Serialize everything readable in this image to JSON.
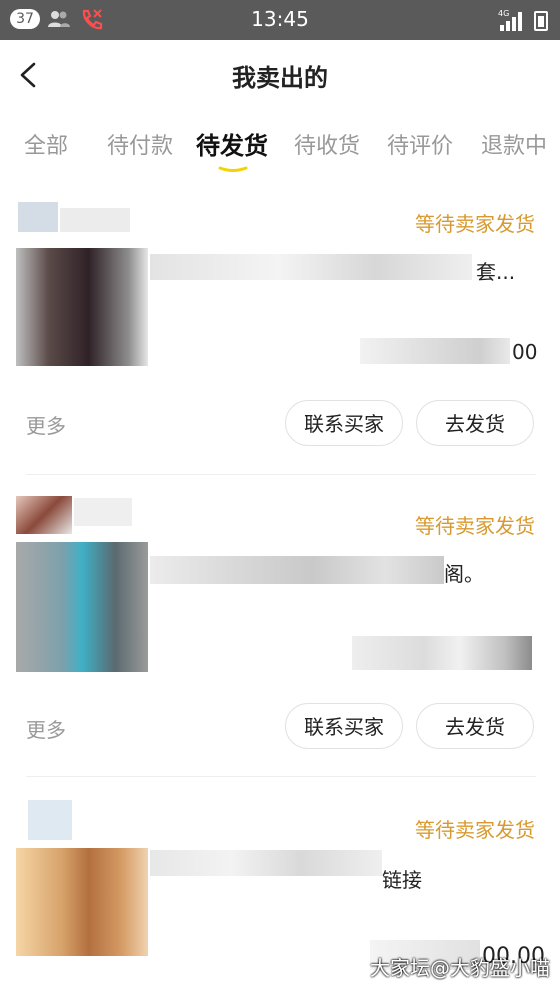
{
  "status_bar": {
    "notification_count": "37",
    "time": "13:45",
    "network": "4G"
  },
  "header": {
    "title": "我卖出的"
  },
  "tabs": [
    {
      "label": "全部"
    },
    {
      "label": "待付款"
    },
    {
      "label": "待发货"
    },
    {
      "label": "待收货"
    },
    {
      "label": "待评价"
    },
    {
      "label": "退款中"
    }
  ],
  "active_tab": "待发货",
  "orders": [
    {
      "status": "等待卖家发货",
      "title_tail": "套...",
      "price_tail": "00",
      "more_label": "更多",
      "contact_label": "联系买家",
      "ship_label": "去发货"
    },
    {
      "status": "等待卖家发货",
      "title_tail": "阁。",
      "more_label": "更多",
      "contact_label": "联系买家",
      "ship_label": "去发货"
    },
    {
      "status": "等待卖家发货",
      "title_tail": "链接",
      "price_tail": "00.00"
    }
  ],
  "watermark": "大家坛@大豹盛小喵",
  "colors": {
    "status_bar": "#5a5a5a",
    "accent": "#d89a2f",
    "tab_indicator": "#f5d300",
    "muted": "#999999"
  },
  "icons": {
    "back": "chevron-left",
    "contacts": "people-icon",
    "missed_call": "phone-icon"
  }
}
